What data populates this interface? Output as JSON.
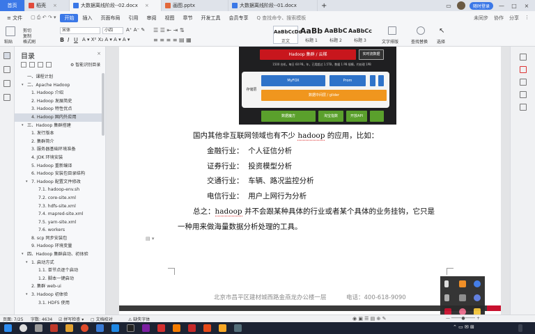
{
  "titlebar": {
    "tabs": [
      {
        "label": "首页",
        "color": "#3b78e7"
      },
      {
        "label": "稻壳",
        "color": "#e24a3b"
      },
      {
        "label": "大数据离线阶段--02.docx",
        "color": "#3b78e7"
      },
      {
        "label": "画图.pptx",
        "color": "#e2683b"
      },
      {
        "label": "大数据离线阶段--01.docx",
        "color": "#3b78e7"
      }
    ],
    "add_tab": "+",
    "login": "随时登录",
    "colors": {
      "accent": "#3b78e7"
    }
  },
  "menubar": {
    "file": "文件",
    "items": [
      "开始",
      "插入",
      "页面布局",
      "引用",
      "审阅",
      "视图",
      "章节",
      "开发工具",
      "会员专享"
    ],
    "search": "Q 查找命令、搜索模板",
    "right": [
      "未同步",
      "协作",
      "分享"
    ]
  },
  "ribbon": {
    "paste": "粘贴",
    "cut": "剪切",
    "copy": "复制",
    "format_painter": "格式刷",
    "font_name": "宋体",
    "font_size": "小四",
    "styles": [
      {
        "sample": "AaBbCcDd",
        "caption": "正文"
      },
      {
        "sample": "AaBb",
        "caption": "标题 1"
      },
      {
        "sample": "AaBbC",
        "caption": "标题 2"
      },
      {
        "sample": "AaBbCc",
        "caption": "标题 3"
      }
    ],
    "text_layout": "文字排版",
    "find_replace": "查找替换",
    "select": "选择"
  },
  "nav": {
    "title": "目录",
    "smart": "智能识别目录",
    "items": [
      {
        "label": "一、课程计划",
        "level": 1,
        "arrow": ""
      },
      {
        "label": "二、Apache Hadoop",
        "level": 1,
        "arrow": "v"
      },
      {
        "label": "1. Hadoop 介绍",
        "level": 2,
        "arrow": ""
      },
      {
        "label": "2. Hadoop 发展简史",
        "level": 2,
        "arrow": ""
      },
      {
        "label": "3. Hadoop 特性优点",
        "level": 2,
        "arrow": ""
      },
      {
        "label": "4. Hadoop 国内外应用",
        "level": 2,
        "arrow": "",
        "selected": true
      },
      {
        "label": "三、Hadoop 集群搭建",
        "level": 1,
        "arrow": "v"
      },
      {
        "label": "1. 发行版本",
        "level": 2,
        "arrow": ""
      },
      {
        "label": "2. 集群简介",
        "level": 2,
        "arrow": ""
      },
      {
        "label": "3. 服务器基础环境准备",
        "level": 2,
        "arrow": ""
      },
      {
        "label": "4. JDK 环境安装",
        "level": 2,
        "arrow": ""
      },
      {
        "label": "5. Hadoop 重新编译",
        "level": 2,
        "arrow": ""
      },
      {
        "label": "6. Hadoop 安装包目录结构",
        "level": 2,
        "arrow": ""
      },
      {
        "label": "7. Hadoop 配置文件修改",
        "level": 2,
        "arrow": "v"
      },
      {
        "label": "7.1. hadoop-env.sh",
        "level": 3,
        "arrow": ""
      },
      {
        "label": "7.2. core-site.xml",
        "level": 3,
        "arrow": ""
      },
      {
        "label": "7.3. hdfs-site.xml",
        "level": 3,
        "arrow": ""
      },
      {
        "label": "7.4. mapred-site.xml",
        "level": 3,
        "arrow": ""
      },
      {
        "label": "7.5. yarn-site.xml",
        "level": 3,
        "arrow": ""
      },
      {
        "label": "7.6. workers",
        "level": 3,
        "arrow": ""
      },
      {
        "label": "8. scp 同步安装包",
        "level": 2,
        "arrow": ""
      },
      {
        "label": "9. Hadoop 环境变量",
        "level": 2,
        "arrow": ""
      },
      {
        "label": "四、Hadoop 集群启动、初体验",
        "level": 1,
        "arrow": "v"
      },
      {
        "label": "1. 启动方式",
        "level": 2,
        "arrow": "v"
      },
      {
        "label": "1.1. 单节点逐个启动",
        "level": 3,
        "arrow": ""
      },
      {
        "label": "1.2. 脚本一键启动",
        "level": 3,
        "arrow": ""
      },
      {
        "label": "2. 集群 web-ui",
        "level": 2,
        "arrow": ""
      },
      {
        "label": "3. Hadoop 初体验",
        "level": 2,
        "arrow": "v"
      },
      {
        "label": "3.1. HDFS 使用",
        "level": 3,
        "arrow": ""
      }
    ]
  },
  "diagram": {
    "top": "Hadoop 集群 / 云梯",
    "top_right": "实时流数据",
    "stats": "1500 台机，每日 60 PB，年，已用超过 1.5TB，数据 1 PB 规模，约处理 1PB",
    "side": "存储层",
    "myfox": "MyFOX",
    "prom": "Prom",
    "middleware": "数据中间层 / glider",
    "bottom": [
      "数据魔方",
      "淘宝指数",
      "开放API"
    ]
  },
  "document": {
    "intro_a": "国内其他非互联网领域也有不少",
    "intro_b": "hadoop",
    "intro_c": "的应用，比如：",
    "items": [
      {
        "label": "金融行业：",
        "value": "个人征信分析"
      },
      {
        "label": "证券行业：",
        "value": "投资模型分析"
      },
      {
        "label": "交通行业：",
        "value": "车辆、路况监控分析"
      },
      {
        "label": "电信行业：",
        "value": "用户上网行为分析"
      }
    ],
    "summary_a": "总之：",
    "summary_b": "hadoop",
    "summary_c": "并不会跟某种具体的行业或者某个具体的业务挂钩，它只是",
    "summary_line2": "一种用来做海量数据分析处理的工具。",
    "footer_address": "北京市昌平区建材城西路金燕龙办公楼一层",
    "footer_phone": "电话：400-618-9090"
  },
  "statusbar": {
    "page": "页面: 7/25",
    "words": "字数: 4634",
    "spell": "拼写检查",
    "proofread": "文档校对",
    "missing_font": "缺失字体"
  }
}
